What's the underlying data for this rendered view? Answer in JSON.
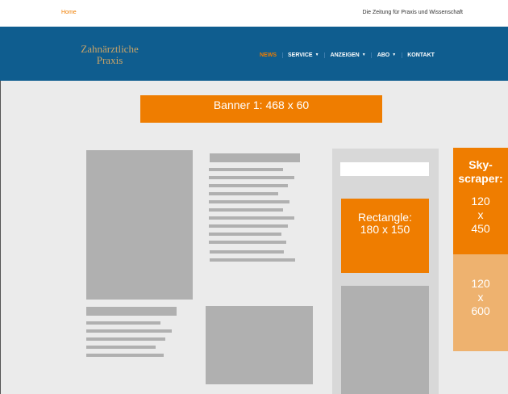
{
  "topbar": {
    "home": "Home",
    "tagline": "Die Zeitung für Praxis und Wissenschaft"
  },
  "header": {
    "logo_line1": "Zahnärztliche",
    "logo_line2": "Praxis",
    "nav": [
      {
        "label": "NEWS",
        "active": true
      },
      {
        "label": "SERVICE",
        "dropdown": true
      },
      {
        "label": "ANZEIGEN",
        "dropdown": true
      },
      {
        "label": "ABO",
        "dropdown": true
      },
      {
        "label": "KONTAKT"
      }
    ]
  },
  "ads": {
    "banner": "Banner 1: 468 x 60",
    "rectangle_line1": "Rectangle:",
    "rectangle_line2": "180 x 150",
    "sky_line1": "Sky-",
    "sky_line2": "scraper:",
    "sky_w": "120",
    "sky_x": "x",
    "sky_h1": "450",
    "sky_w2": "120",
    "sky_x2": "x",
    "sky_h2": "600"
  },
  "colors": {
    "accent": "#ef7d00",
    "header_bg": "#0f5d8f",
    "logo": "#c9a468"
  },
  "icons": {
    "dropdown": "chevron-down-icon"
  }
}
